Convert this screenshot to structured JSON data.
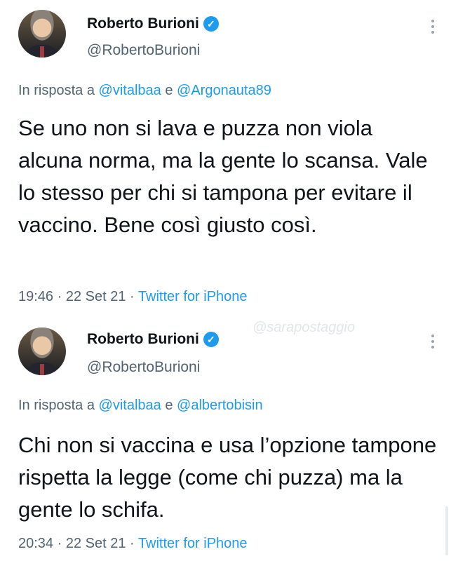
{
  "tweets": [
    {
      "author_name": "Roberto Burioni",
      "handle": "@RobertoBurioni",
      "reply_prefix": "In risposta a",
      "mention_1": "@vitalbaa",
      "reply_joiner": "e",
      "mention_2": "@Argonauta89",
      "text": "Se uno non si lava e puzza non viola alcuna norma, ma la gente lo scansa. Vale lo stesso per chi si tampona per evitare il vaccino. Bene così giusto così.",
      "time": "19:46",
      "date": "22 Set 21",
      "source": "Twitter for iPhone"
    },
    {
      "author_name": "Roberto Burioni",
      "handle": "@RobertoBurioni",
      "reply_prefix": "In risposta a",
      "mention_1": "@vitalbaa",
      "reply_joiner": "e",
      "mention_2": "@albertobisin",
      "text": "Chi non si vaccina e usa l’opzione tampone rispetta la legge (come chi puzza) ma la gente lo schifa.",
      "time": "20:34",
      "date": "22 Set 21",
      "source": "Twitter for iPhone"
    }
  ],
  "separator": "·",
  "watermark": "@sarapostaggio",
  "colors": {
    "link": "#1d9bf0",
    "secondary_text": "#536471",
    "primary_text": "#0f1419"
  },
  "icons": {
    "verified": "verified-badge-icon",
    "more": "more-options-icon"
  }
}
